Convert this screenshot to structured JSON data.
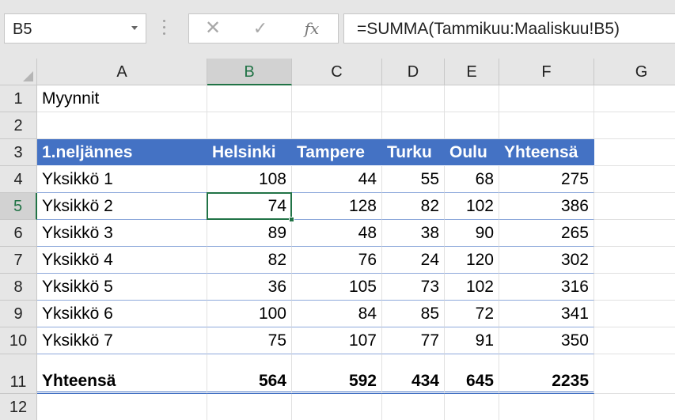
{
  "name_box": "B5",
  "formula": "=SUMMA(Tammikuu:Maaliskuu!B5)",
  "formula_buttons": {
    "cancel": "✕",
    "enter": "✓",
    "fx": "fx"
  },
  "columns": [
    "A",
    "B",
    "C",
    "D",
    "E",
    "F",
    "G"
  ],
  "selected_column": "B",
  "selected_row": "5",
  "rows": [
    {
      "n": "1",
      "cells": [
        "Myynnit",
        "",
        "",
        "",
        "",
        "",
        ""
      ]
    },
    {
      "n": "2",
      "cells": [
        "",
        "",
        "",
        "",
        "",
        "",
        ""
      ]
    },
    {
      "n": "3",
      "cells": [
        "1.neljännes",
        "Helsinki",
        "Tampere",
        "Turku",
        "Oulu",
        "Yhteensä",
        ""
      ]
    },
    {
      "n": "4",
      "cells": [
        "Yksikkö 1",
        "108",
        "44",
        "55",
        "68",
        "275",
        ""
      ]
    },
    {
      "n": "5",
      "cells": [
        "Yksikkö 2",
        "74",
        "128",
        "82",
        "102",
        "386",
        ""
      ]
    },
    {
      "n": "6",
      "cells": [
        "Yksikkö 3",
        "89",
        "48",
        "38",
        "90",
        "265",
        ""
      ]
    },
    {
      "n": "7",
      "cells": [
        "Yksikkö 4",
        "82",
        "76",
        "24",
        "120",
        "302",
        ""
      ]
    },
    {
      "n": "8",
      "cells": [
        "Yksikkö 5",
        "36",
        "105",
        "73",
        "102",
        "316",
        ""
      ]
    },
    {
      "n": "9",
      "cells": [
        "Yksikkö 6",
        "100",
        "84",
        "85",
        "72",
        "341",
        ""
      ]
    },
    {
      "n": "10",
      "cells": [
        "Yksikkö 7",
        "75",
        "107",
        "77",
        "91",
        "350",
        ""
      ]
    },
    {
      "n": "11",
      "cells": [
        "Yhteensä",
        "564",
        "592",
        "434",
        "645",
        "2235",
        ""
      ]
    },
    {
      "n": "12",
      "cells": [
        "",
        "",
        "",
        "",
        "",
        "",
        ""
      ]
    }
  ],
  "colors": {
    "table_header": "#4472c4",
    "band_line": "#8ea9db",
    "selection": "#217346"
  }
}
